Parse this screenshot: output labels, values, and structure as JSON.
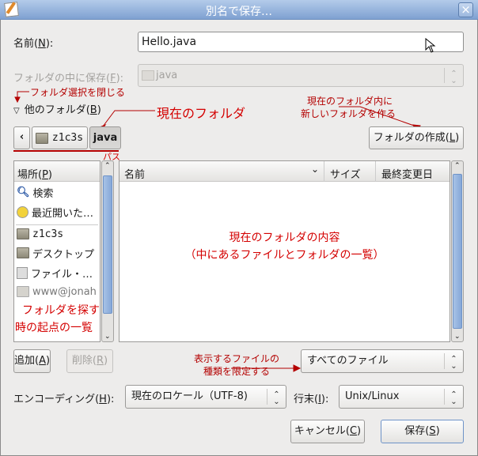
{
  "window": {
    "title": "別名で保存…",
    "close_icon": "×"
  },
  "name": {
    "label": "名前(",
    "mnemonic": "N",
    "label_end": "):",
    "value": "Hello.java"
  },
  "save_in": {
    "label": "フォルダの中に保存(",
    "mnemonic": "F",
    "label_end": "):",
    "value": "java"
  },
  "expander": {
    "label": "他のフォルダ(",
    "mnemonic": "B",
    "label_end": ")"
  },
  "pathbar": {
    "back": "‹",
    "items": [
      {
        "label": "z1c3s"
      },
      {
        "label": "java"
      }
    ]
  },
  "create_folder": {
    "label": "フォルダの作成(",
    "mnemonic": "L",
    "label_end": ")"
  },
  "places": {
    "header": "場所(",
    "mnemonic": "P",
    "header_end": ")",
    "items": [
      {
        "label": "検索",
        "icon": "search-icon"
      },
      {
        "label": "最近開いた…",
        "icon": "recent-icon"
      },
      {
        "label": "z1c3s",
        "icon": "home-folder-icon"
      },
      {
        "label": "デスクトップ",
        "icon": "desktop-folder-icon"
      },
      {
        "label": "ファイル・…",
        "icon": "filesystem-icon"
      },
      {
        "label": "www@jonah",
        "icon": "network-folder-icon"
      }
    ]
  },
  "files": {
    "columns": [
      "名前",
      "サイズ",
      "最終変更日"
    ]
  },
  "buttons": {
    "add": "追加(",
    "add_m": "A",
    "remove": "削除(",
    "remove_m": "R",
    "close": ")",
    "cancel": "キャンセル(",
    "cancel_m": "C",
    "save": "保存(",
    "save_m": "S"
  },
  "filter": {
    "value": "すべてのファイル"
  },
  "encoding": {
    "label": "エンコーディング(",
    "mnemonic": "H",
    "label_end": "):",
    "value": "現在のロケール（UTF-8)"
  },
  "line_end": {
    "label": "行末(",
    "mnemonic": "I",
    "label_end": "):",
    "value": "Unix/Linux"
  },
  "annotations": {
    "close_selector": "フォルダ選択を閉じる",
    "current_folder": "現在のフォルダ",
    "new_folder_1": "現在のフォルダ内に",
    "new_folder_2": "新しいフォルダを作る",
    "path": "パス",
    "contents_1": "現在のフォルダの内容",
    "contents_2": "（中にあるファイルとフォルダの一覧）",
    "places_1": "フォルダを探す",
    "places_2": "時の起点の一覧",
    "filter_1": "表示するファイルの",
    "filter_2": "種類を限定する"
  },
  "colors": {
    "annotation": "#d40000",
    "titlebar": "#7fa1d1"
  }
}
